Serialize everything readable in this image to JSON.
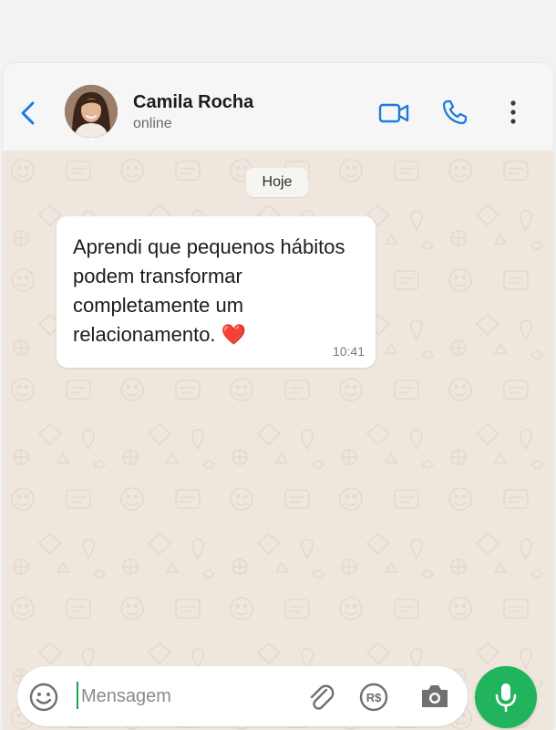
{
  "header": {
    "contact_name": "Camila Rocha",
    "contact_status": "online",
    "icons": [
      "back-arrow-icon",
      "video-call-icon",
      "voice-call-icon",
      "more-options-icon"
    ]
  },
  "chat": {
    "day_label": "Hoje",
    "messages": [
      {
        "text": "Aprendi que pequenos hábitos podem transformar completamente um relacionamento. ❤️",
        "time": "10:41"
      }
    ]
  },
  "composer": {
    "placeholder": "Mensagem",
    "pay_label": "R$",
    "icons": [
      "emoji-icon",
      "attach-icon",
      "payment-icon",
      "camera-icon",
      "microphone-icon"
    ]
  },
  "colors": {
    "accent": "#1f7ae0",
    "wallpaper": "#efe7dd",
    "mic_button": "#22b45c",
    "header_bg": "#f6f6f6"
  }
}
